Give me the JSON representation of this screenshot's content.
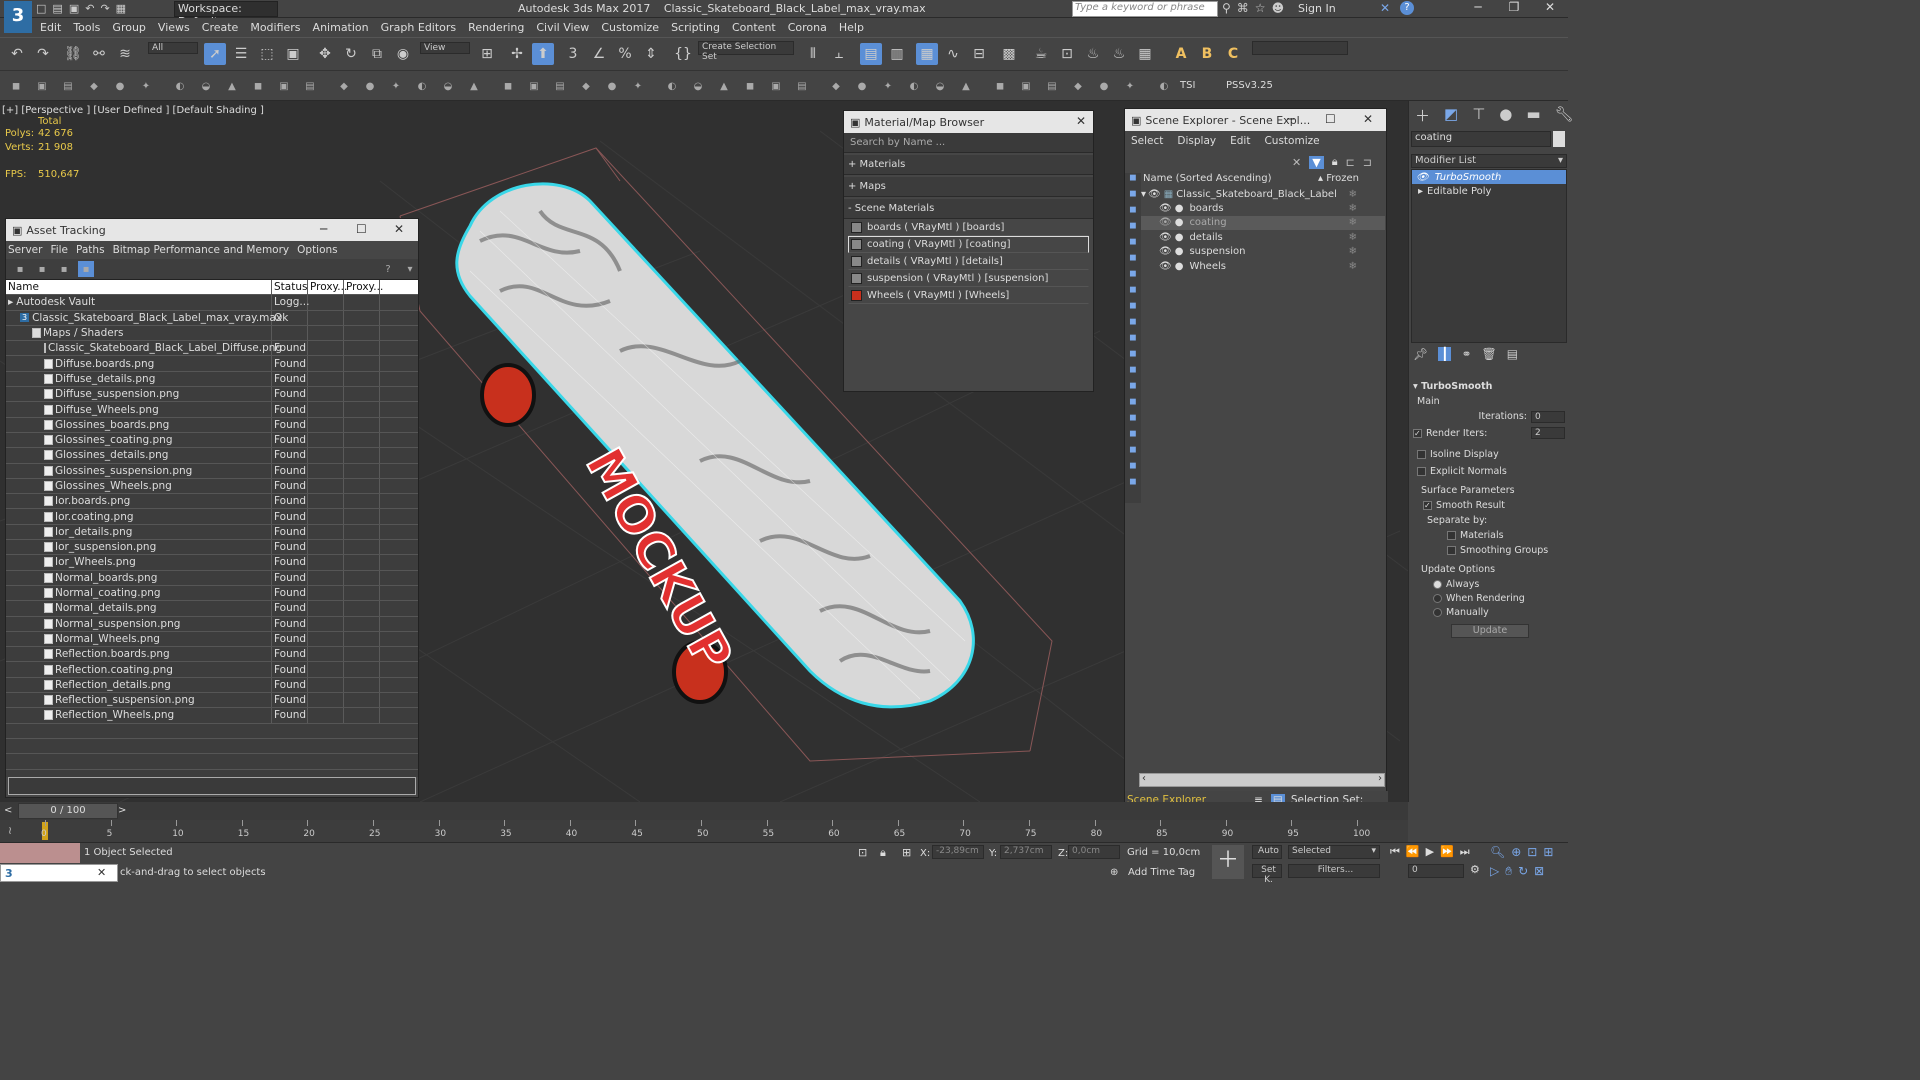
{
  "titlebar": {
    "workspace_label": "Workspace: Default",
    "app_title": "Autodesk 3ds Max 2017",
    "file_title": "Classic_Skateboard_Black_Label_max_vray.max",
    "search_placeholder": "Type a keyword or phrase",
    "sign_in": "Sign In"
  },
  "menu": [
    "Edit",
    "Tools",
    "Group",
    "Views",
    "Create",
    "Modifiers",
    "Animation",
    "Graph Editors",
    "Rendering",
    "Civil View",
    "Customize",
    "Scripting",
    "Content",
    "Corona",
    "Help"
  ],
  "toolbar": {
    "filter_all": "All",
    "ref_coord": "View",
    "create_selection_set": "Create Selection Set",
    "tsi": "TSI",
    "pss": "PSSv3.25"
  },
  "viewport": {
    "label": "[+] [Perspective ] [User Defined ] [Default Shading ]",
    "total": "Total",
    "polys_label": "Polys:",
    "polys_value": "42 676",
    "verts_label": "Verts:",
    "verts_value": "21 908",
    "fps_label": "FPS:",
    "fps_value": "510,647",
    "deck_text": "MOCKUP"
  },
  "asset_tracking": {
    "title": "Asset Tracking",
    "menu": [
      "Server",
      "File",
      "Paths",
      "Bitmap Performance and Memory",
      "Options"
    ],
    "columns": [
      "Name",
      "Status",
      "Proxy...",
      "Proxy..."
    ],
    "rows": [
      {
        "name": "Autodesk Vault",
        "status": "Logg...",
        "indent": 0,
        "type": "vault"
      },
      {
        "name": "Classic_Skateboard_Black_Label_max_vray.max",
        "status": "Ok",
        "indent": 1,
        "type": "max"
      },
      {
        "name": "Maps / Shaders",
        "status": "",
        "indent": 2,
        "type": "folder"
      },
      {
        "name": "Classic_Skateboard_Black_Label_Diffuse.png",
        "status": "Found",
        "indent": 3,
        "type": "file"
      },
      {
        "name": "Diffuse.boards.png",
        "status": "Found",
        "indent": 3,
        "type": "file"
      },
      {
        "name": "Diffuse_details.png",
        "status": "Found",
        "indent": 3,
        "type": "file"
      },
      {
        "name": "Diffuse_suspension.png",
        "status": "Found",
        "indent": 3,
        "type": "file"
      },
      {
        "name": "Diffuse_Wheels.png",
        "status": "Found",
        "indent": 3,
        "type": "file"
      },
      {
        "name": "Glossines_boards.png",
        "status": "Found",
        "indent": 3,
        "type": "file"
      },
      {
        "name": "Glossines_coating.png",
        "status": "Found",
        "indent": 3,
        "type": "file"
      },
      {
        "name": "Glossines_details.png",
        "status": "Found",
        "indent": 3,
        "type": "file"
      },
      {
        "name": "Glossines_suspension.png",
        "status": "Found",
        "indent": 3,
        "type": "file"
      },
      {
        "name": "Glossines_Wheels.png",
        "status": "Found",
        "indent": 3,
        "type": "file"
      },
      {
        "name": "Ior.boards.png",
        "status": "Found",
        "indent": 3,
        "type": "file"
      },
      {
        "name": "Ior.coating.png",
        "status": "Found",
        "indent": 3,
        "type": "file"
      },
      {
        "name": "Ior_details.png",
        "status": "Found",
        "indent": 3,
        "type": "file"
      },
      {
        "name": "Ior_suspension.png",
        "status": "Found",
        "indent": 3,
        "type": "file"
      },
      {
        "name": "Ior_Wheels.png",
        "status": "Found",
        "indent": 3,
        "type": "file"
      },
      {
        "name": "Normal_boards.png",
        "status": "Found",
        "indent": 3,
        "type": "file"
      },
      {
        "name": "Normal_coating.png",
        "status": "Found",
        "indent": 3,
        "type": "file"
      },
      {
        "name": "Normal_details.png",
        "status": "Found",
        "indent": 3,
        "type": "file"
      },
      {
        "name": "Normal_suspension.png",
        "status": "Found",
        "indent": 3,
        "type": "file"
      },
      {
        "name": "Normal_Wheels.png",
        "status": "Found",
        "indent": 3,
        "type": "file"
      },
      {
        "name": "Reflection.boards.png",
        "status": "Found",
        "indent": 3,
        "type": "file"
      },
      {
        "name": "Reflection.coating.png",
        "status": "Found",
        "indent": 3,
        "type": "file"
      },
      {
        "name": "Reflection_details.png",
        "status": "Found",
        "indent": 3,
        "type": "file"
      },
      {
        "name": "Reflection_suspension.png",
        "status": "Found",
        "indent": 3,
        "type": "file"
      },
      {
        "name": "Reflection_Wheels.png",
        "status": "Found",
        "indent": 3,
        "type": "file"
      }
    ]
  },
  "material_browser": {
    "title": "Material/Map Browser",
    "search_placeholder": "Search by Name ...",
    "groups": [
      "+ Materials",
      "+ Maps",
      "- Scene Materials"
    ],
    "materials": [
      {
        "label": "boards  ( VRayMtl )  [boards]",
        "selected": false
      },
      {
        "label": "coating  ( VRayMtl )  [coating]",
        "selected": true
      },
      {
        "label": "details  ( VRayMtl )  [details]",
        "selected": false
      },
      {
        "label": "suspension  ( VRayMtl )  [suspension]",
        "selected": false
      },
      {
        "label": "Wheels  ( VRayMtl )  [Wheels]",
        "selected": false
      }
    ]
  },
  "scene_explorer": {
    "title": "Scene Explorer - Scene Expl...",
    "menu": [
      "Select",
      "Display",
      "Edit",
      "Customize"
    ],
    "col_name": "Name (Sorted Ascending)",
    "col_frozen": "▴ Frozen",
    "root": "Classic_Skateboard_Black_Label",
    "children": [
      "boards",
      "coating",
      "details",
      "suspension",
      "Wheels"
    ],
    "selected_child": "coating",
    "footer_label": "Scene Explorer",
    "selection_set_label": "Selection Set:"
  },
  "command_panel": {
    "search_value": "coating",
    "modifier_list": "Modifier List",
    "stack": [
      "TurboSmooth",
      "Editable Poly"
    ],
    "turbosmooth": {
      "title": "TurboSmooth",
      "main": "Main",
      "iterations_label": "Iterations:",
      "iterations_value": "0",
      "render_iters_label": "Render Iters:",
      "render_iters_value": "2",
      "isoline": "Isoline Display",
      "explicit_normals": "Explicit Normals",
      "surface_params": "Surface Parameters",
      "smooth_result": "Smooth Result",
      "separate_by": "Separate by:",
      "materials": "Materials",
      "smoothing_groups": "Smoothing Groups",
      "update_options": "Update Options",
      "always": "Always",
      "when_rendering": "When Rendering",
      "manually": "Manually",
      "update_button": "Update"
    }
  },
  "timeline": {
    "frame_display": "0 / 100",
    "ticks": [
      "0",
      "5",
      "10",
      "15",
      "20",
      "25",
      "30",
      "35",
      "40",
      "45",
      "50",
      "55",
      "60",
      "65",
      "70",
      "75",
      "80",
      "85",
      "90",
      "95",
      "100"
    ]
  },
  "status": {
    "selected": "1 Object Selected",
    "hint": "ck-and-drag to select objects",
    "x_label": "X:",
    "x_value": "-23,89cm",
    "y_label": "Y:",
    "y_value": "2,737cm",
    "z_label": "Z:",
    "z_value": "0,0cm",
    "grid": "Grid = 10,0cm",
    "add_time_tag": "Add Time Tag",
    "auto": "Auto",
    "setk": "Set K.",
    "selected_dropdown": "Selected",
    "filters": "Filters...",
    "frame_spinner": "0"
  },
  "colors": {
    "accent_blue": "#5b8fd6",
    "deck_outline": "#39d7e8",
    "wheel_red": "#d42a16",
    "stat_yellow": "#e8c94a"
  }
}
